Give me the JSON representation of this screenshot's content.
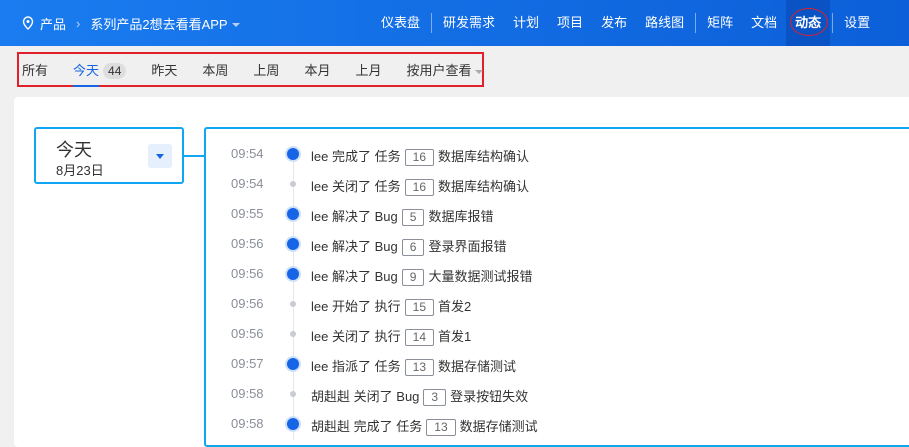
{
  "header": {
    "product_label": "产品",
    "product_name": "系列产品2想去看看APP",
    "nav": [
      {
        "label": "仪表盘"
      },
      {
        "label": "研发需求"
      },
      {
        "label": "计划"
      },
      {
        "label": "项目"
      },
      {
        "label": "发布"
      },
      {
        "label": "路线图"
      },
      {
        "label": "矩阵"
      },
      {
        "label": "文档"
      },
      {
        "label": "动态"
      },
      {
        "label": "设置"
      }
    ]
  },
  "filters": {
    "all": "所有",
    "today": "今天",
    "today_count": "44",
    "yesterday": "昨天",
    "this_week": "本周",
    "last_week": "上周",
    "this_month": "本月",
    "last_month": "上月",
    "by_user": "按用户查看"
  },
  "date": {
    "label": "今天",
    "date": "8月23日"
  },
  "actions": [
    {
      "time": "09:54",
      "actor": "lee",
      "action": "完成了",
      "type": "任务",
      "id": "16",
      "title": "数据库结构确认",
      "major": true
    },
    {
      "time": "09:54",
      "actor": "lee",
      "action": "关闭了",
      "type": "任务",
      "id": "16",
      "title": "数据库结构确认",
      "major": false
    },
    {
      "time": "09:55",
      "actor": "lee",
      "action": "解决了",
      "type": "Bug",
      "id": "5",
      "title": "数据库报错",
      "major": true
    },
    {
      "time": "09:56",
      "actor": "lee",
      "action": "解决了",
      "type": "Bug",
      "id": "6",
      "title": "登录界面报错",
      "major": true
    },
    {
      "time": "09:56",
      "actor": "lee",
      "action": "解决了",
      "type": "Bug",
      "id": "9",
      "title": "大量数据测试报错",
      "major": true
    },
    {
      "time": "09:56",
      "actor": "lee",
      "action": "开始了",
      "type": "执行",
      "id": "15",
      "title": "首发2",
      "major": false
    },
    {
      "time": "09:56",
      "actor": "lee",
      "action": "关闭了",
      "type": "执行",
      "id": "14",
      "title": "首发1",
      "major": false
    },
    {
      "time": "09:57",
      "actor": "lee",
      "action": "指派了",
      "type": "任务",
      "id": "13",
      "title": "数据存储测试",
      "major": true
    },
    {
      "time": "09:58",
      "actor": "胡赳赳",
      "action": "关闭了",
      "type": "Bug",
      "id": "3",
      "title": "登录按钮失效",
      "major": false
    },
    {
      "time": "09:58",
      "actor": "胡赳赳",
      "action": "完成了",
      "type": "任务",
      "id": "13",
      "title": "数据存储测试",
      "major": true
    }
  ]
}
